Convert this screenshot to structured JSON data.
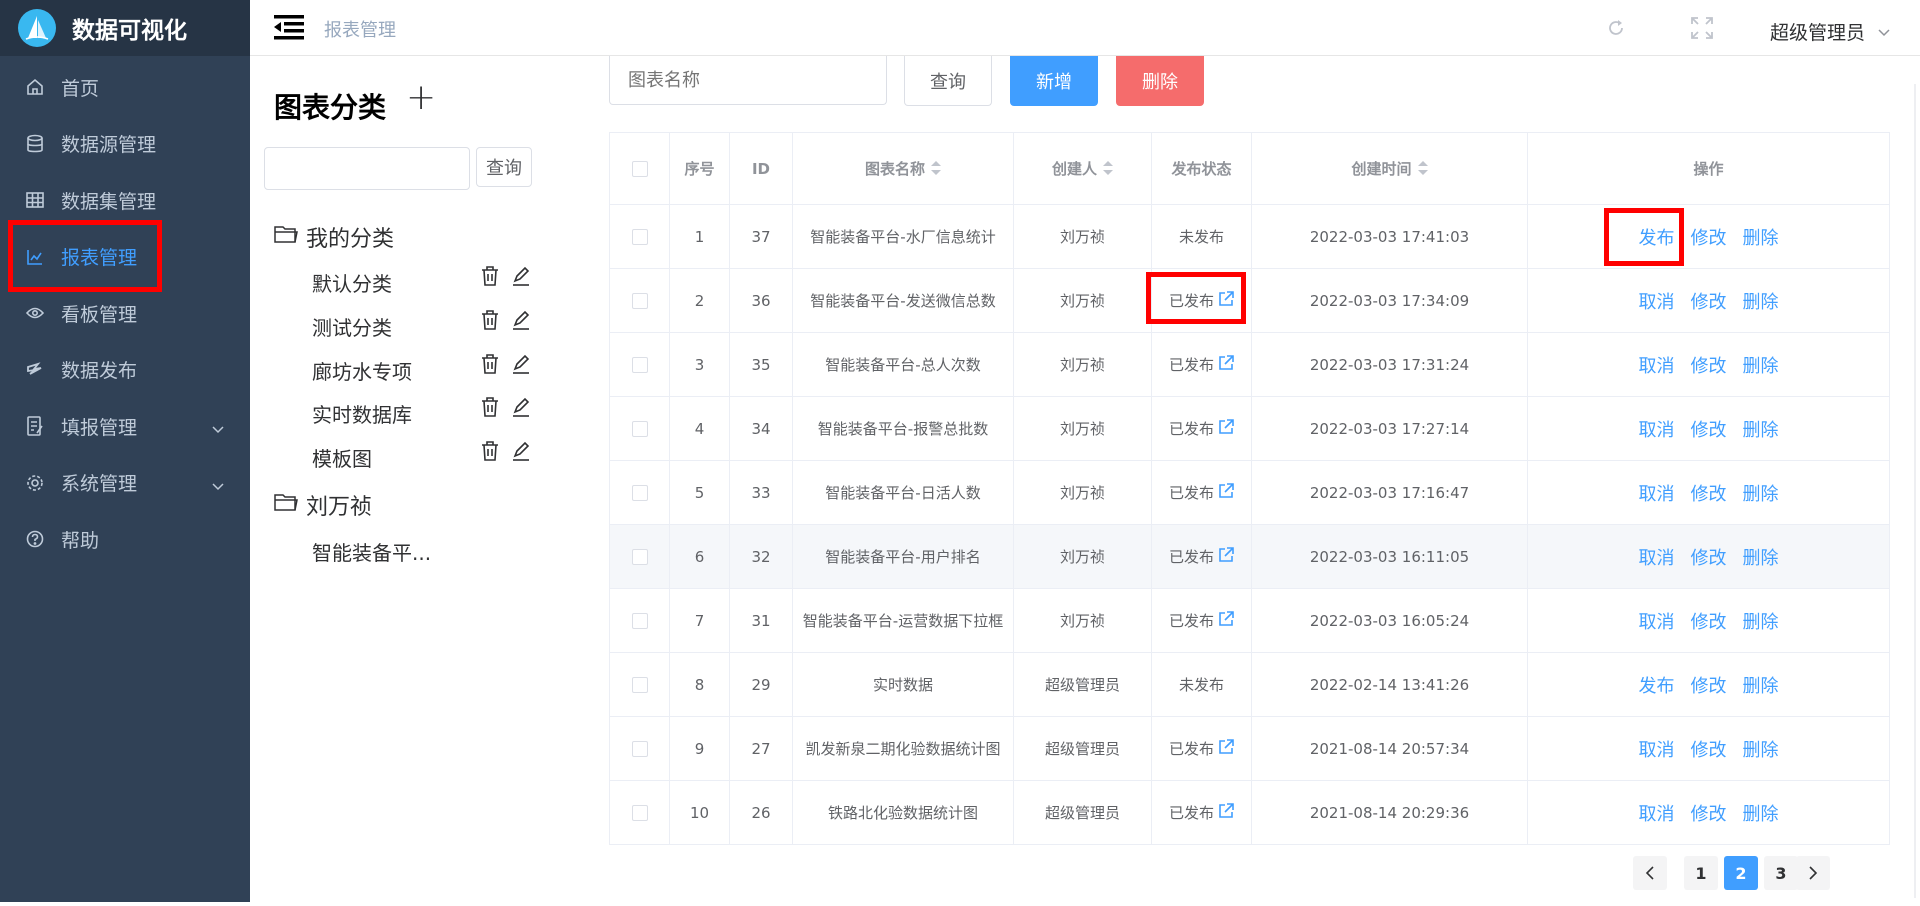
{
  "app": {
    "title": "数据可视化"
  },
  "sidebar": {
    "items": [
      {
        "label": "首页",
        "icon": "home-icon"
      },
      {
        "label": "数据源管理",
        "icon": "database-icon"
      },
      {
        "label": "数据集管理",
        "icon": "table-icon"
      },
      {
        "label": "报表管理",
        "icon": "chart-icon",
        "active": true
      },
      {
        "label": "看板管理",
        "icon": "eye-icon"
      },
      {
        "label": "数据发布",
        "icon": "publish-icon"
      },
      {
        "label": "填报管理",
        "icon": "form-icon",
        "expandable": true
      },
      {
        "label": "系统管理",
        "icon": "gear-icon",
        "expandable": true
      },
      {
        "label": "帮助",
        "icon": "help-icon"
      }
    ]
  },
  "header": {
    "breadcrumb": "报表管理",
    "user": "超级管理员"
  },
  "category_panel": {
    "title": "图表分类",
    "add_symbol": "+",
    "search_placeholder": "",
    "query_label": "查询",
    "groups": [
      {
        "label": "我的分类",
        "items": [
          "默认分类",
          "测试分类",
          "廊坊水专项",
          "实时数据库",
          "模板图"
        ]
      },
      {
        "label": "刘万祯",
        "items": [
          "智能装备平..."
        ]
      }
    ]
  },
  "toolbar": {
    "search_placeholder": "图表名称",
    "query_label": "查询",
    "add_label": "新增",
    "delete_label": "删除"
  },
  "table": {
    "headers": [
      "序号",
      "ID",
      "图表名称",
      "创建人",
      "发布状态",
      "创建时间",
      "操作"
    ],
    "rows": [
      {
        "no": "1",
        "id": "37",
        "name": "智能装备平台-水厂信息统计",
        "creator": "刘万祯",
        "status": "未发布",
        "published": false,
        "time": "2022-03-03 17:41:03",
        "toggle": "发布"
      },
      {
        "no": "2",
        "id": "36",
        "name": "智能装备平台-发送微信总数",
        "creator": "刘万祯",
        "status": "已发布",
        "published": true,
        "time": "2022-03-03 17:34:09",
        "toggle": "取消"
      },
      {
        "no": "3",
        "id": "35",
        "name": "智能装备平台-总人次数",
        "creator": "刘万祯",
        "status": "已发布",
        "published": true,
        "time": "2022-03-03 17:31:24",
        "toggle": "取消"
      },
      {
        "no": "4",
        "id": "34",
        "name": "智能装备平台-报警总批数",
        "creator": "刘万祯",
        "status": "已发布",
        "published": true,
        "time": "2022-03-03 17:27:14",
        "toggle": "取消"
      },
      {
        "no": "5",
        "id": "33",
        "name": "智能装备平台-日活人数",
        "creator": "刘万祯",
        "status": "已发布",
        "published": true,
        "time": "2022-03-03 17:16:47",
        "toggle": "取消"
      },
      {
        "no": "6",
        "id": "32",
        "name": "智能装备平台-用户排名",
        "creator": "刘万祯",
        "status": "已发布",
        "published": true,
        "time": "2022-03-03 16:11:05",
        "toggle": "取消"
      },
      {
        "no": "7",
        "id": "31",
        "name": "智能装备平台-运营数据下拉框",
        "creator": "刘万祯",
        "status": "已发布",
        "published": true,
        "time": "2022-03-03 16:05:24",
        "toggle": "取消"
      },
      {
        "no": "8",
        "id": "29",
        "name": "实时数据",
        "creator": "超级管理员",
        "status": "未发布",
        "published": false,
        "time": "2022-02-14 13:41:26",
        "toggle": "发布"
      },
      {
        "no": "9",
        "id": "27",
        "name": "凯发新泉二期化验数据统计图",
        "creator": "超级管理员",
        "status": "已发布",
        "published": true,
        "time": "2021-08-14 20:57:34",
        "toggle": "取消"
      },
      {
        "no": "10",
        "id": "26",
        "name": "铁路北化验数据统计图",
        "creator": "超级管理员",
        "status": "已发布",
        "published": true,
        "time": "2021-08-14 20:29:36",
        "toggle": "取消"
      }
    ],
    "action_edit": "修改",
    "action_delete": "删除"
  },
  "pagination": {
    "pages": [
      "1",
      "2",
      "3"
    ],
    "current": "2"
  },
  "colors": {
    "sidebar": "#304156",
    "accent": "#409eff",
    "danger": "#f56c6c",
    "highlight": "#ff0000"
  }
}
